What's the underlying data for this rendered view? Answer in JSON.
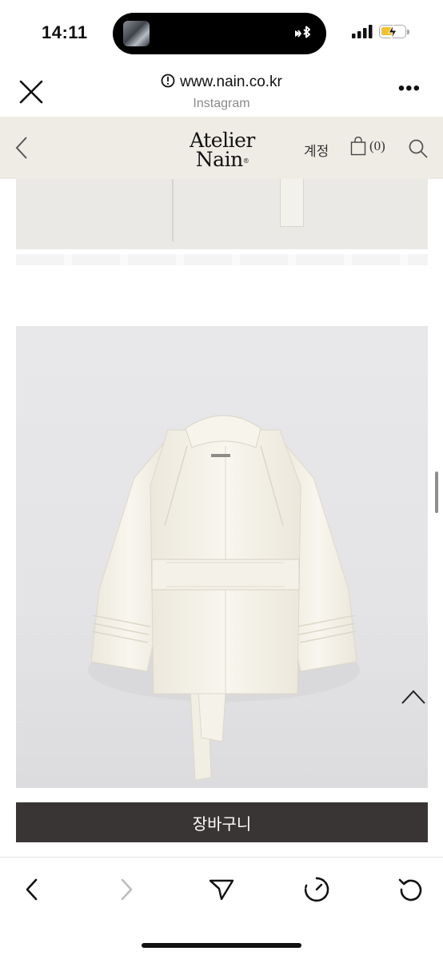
{
  "status_bar": {
    "time": "14:11",
    "island_icon": "bluetooth-icon",
    "signal_icon": "signal-bars-icon",
    "battery_icon": "battery-charging-icon",
    "battery_level": 0.35,
    "battery_color": "#f2c12e"
  },
  "browser": {
    "url": "www.nain.co.kr",
    "source": "Instagram",
    "close_icon": "close-icon",
    "more_label": "•••"
  },
  "site_header": {
    "logo_line1": "Atelier",
    "logo_line2": "Nain",
    "logo_mark": "®",
    "account_label": "계정",
    "cart_count": "(0)",
    "background": "#efece6"
  },
  "product": {
    "image_subject": "coat-photo",
    "cart_button_label": "장바구니",
    "cart_button_color": "#3a3535"
  },
  "toolbar": {
    "back_icon": "chevron-left-icon",
    "forward_icon": "chevron-right-icon",
    "share_icon": "send-icon",
    "speed_icon": "gauge-icon",
    "reload_icon": "reload-icon"
  }
}
